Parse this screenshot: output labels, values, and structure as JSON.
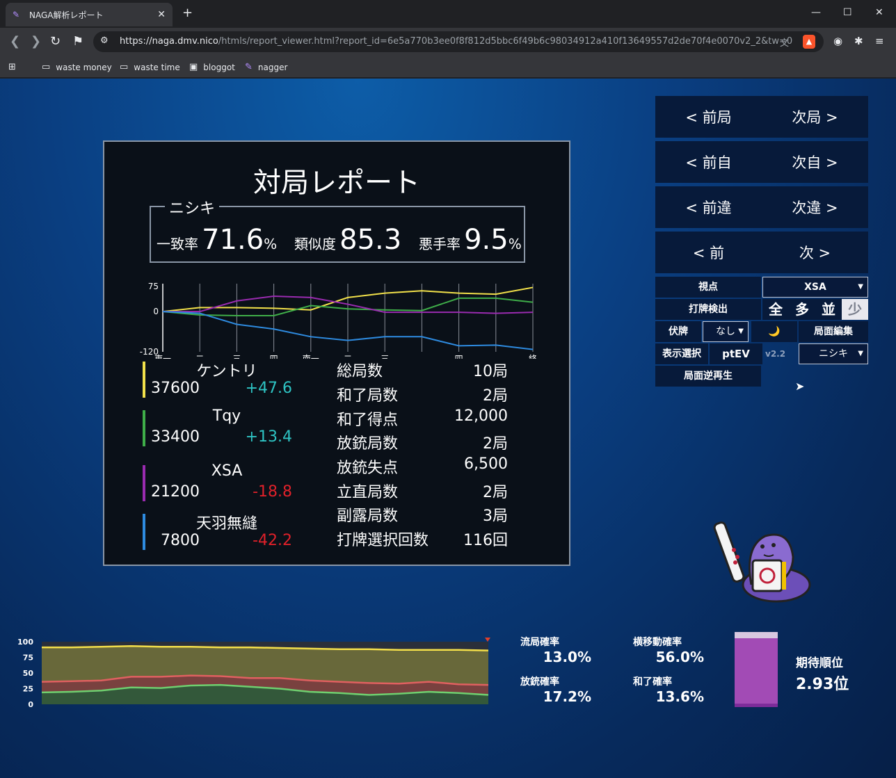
{
  "browser": {
    "tab_title": "NAGA解析レポート",
    "url_host": "https://naga.dmv.nico",
    "url_path": "/htmls/report_viewer.html?report_id=6e5a770b3ee0f8f812d5bbc6f49b6c98034912a410f13649557d2de70f4e0070v2_2&tw=0",
    "bookmarks": [
      "waste money",
      "waste time",
      "bloggot",
      "nagger"
    ]
  },
  "report": {
    "title": "対局レポート",
    "model_name": "ニシキ",
    "agreement_label": "一致率",
    "agreement_value": "71.6",
    "agreement_unit": "%",
    "similarity_label": "類似度",
    "similarity_value": "85.3",
    "bad_rate_label": "悪手率",
    "bad_rate_value": "9.5",
    "bad_rate_unit": "%",
    "players": [
      {
        "name": "ケントリ",
        "points": "37600",
        "diff": "+47.6",
        "color": "#f2e14a",
        "diff_color": "#2ec4c4"
      },
      {
        "name": "Tqy",
        "points": "33400",
        "diff": "+13.4",
        "color": "#3fae49",
        "diff_color": "#2ec4c4"
      },
      {
        "name": "XSA",
        "points": "21200",
        "diff": "-18.8",
        "color": "#9a2bb0",
        "diff_color": "#e0212a"
      },
      {
        "name": "天羽無縫",
        "points": "7800",
        "diff": "-42.2",
        "color": "#2e8be0",
        "diff_color": "#e0212a"
      }
    ],
    "stats": [
      {
        "label": "総局数",
        "value": "10局"
      },
      {
        "label": "和了局数",
        "value": "2局"
      },
      {
        "label": "和了得点",
        "value": "12,000"
      },
      {
        "label": "放銃局数",
        "value": "2局"
      },
      {
        "label": "放銃失点",
        "value": "6,500"
      },
      {
        "label": "立直局数",
        "value": "2局"
      },
      {
        "label": "副露局数",
        "value": "3局"
      },
      {
        "label": "打牌選択回数",
        "value": "116回"
      }
    ]
  },
  "chart_data": [
    {
      "type": "line",
      "ytick_labels": [
        "75",
        "0",
        "-120"
      ],
      "ylim": [
        -120,
        75
      ],
      "x_labels": [
        "東一",
        "二",
        "三",
        "四",
        "南一",
        "二",
        "三",
        "",
        "四",
        "",
        "終"
      ],
      "series": [
        {
          "color": "#f2e14a",
          "values": [
            0,
            12,
            12,
            10,
            5,
            42,
            55,
            62,
            55,
            52,
            72
          ]
        },
        {
          "color": "#3fae49",
          "values": [
            0,
            -10,
            -12,
            -12,
            18,
            8,
            5,
            3,
            40,
            40,
            28
          ]
        },
        {
          "color": "#9a2bb0",
          "values": [
            0,
            0,
            32,
            46,
            42,
            22,
            -2,
            -2,
            -2,
            -5,
            -2
          ]
        },
        {
          "color": "#2e8be0",
          "values": [
            0,
            -5,
            -38,
            -52,
            -75,
            -86,
            -75,
            -75,
            -102,
            -100,
            -113
          ]
        }
      ],
      "grid": true
    },
    {
      "type": "area",
      "ytick_labels": [
        "100",
        "75",
        "50",
        "25",
        "0"
      ],
      "ylim": [
        0,
        100
      ],
      "series": [
        {
          "color": "#f5e04a",
          "values": [
            91,
            91,
            92,
            93,
            92,
            92,
            91,
            91,
            90,
            89,
            88,
            88,
            87,
            87,
            87,
            86
          ]
        },
        {
          "color": "#e06060",
          "values": [
            36,
            37,
            38,
            44,
            44,
            46,
            45,
            42,
            42,
            38,
            36,
            34,
            33,
            36,
            32,
            31
          ]
        },
        {
          "color": "#6fcf6f",
          "values": [
            19,
            20,
            22,
            27,
            26,
            30,
            31,
            28,
            25,
            20,
            18,
            15,
            17,
            20,
            18,
            15
          ]
        }
      ]
    }
  ],
  "panel": {
    "nav": [
      {
        "prev": "< 前局",
        "next": "次局 >"
      },
      {
        "prev": "< 前自",
        "next": "次自 >"
      },
      {
        "prev": "< 前違",
        "next": "次違 >"
      },
      {
        "prev": "< 前",
        "next": "次 >"
      }
    ],
    "viewpoint_label": "視点",
    "viewpoint_value": "XSA",
    "detect_label": "打牌検出",
    "detect_options": [
      "全",
      "多",
      "並",
      "少"
    ],
    "hide_label": "伏牌",
    "hide_value": "なし",
    "moon": "🌙",
    "edit_label": "局面編集",
    "display_label": "表示選択",
    "display_value": "ptEV",
    "version": "v2.2",
    "model_value": "ニシキ",
    "reverse_label": "局面逆再生"
  },
  "probabilities": {
    "draw_label": "流局確率",
    "draw_value": "13.0%",
    "side_label": "横移動確率",
    "side_value": "56.0%",
    "deal_in_label": "放銃確率",
    "deal_in_value": "17.2%",
    "win_label": "和了確率",
    "win_value": "13.6%",
    "expected_rank_label": "期待順位",
    "expected_rank_value": "2.93位"
  }
}
